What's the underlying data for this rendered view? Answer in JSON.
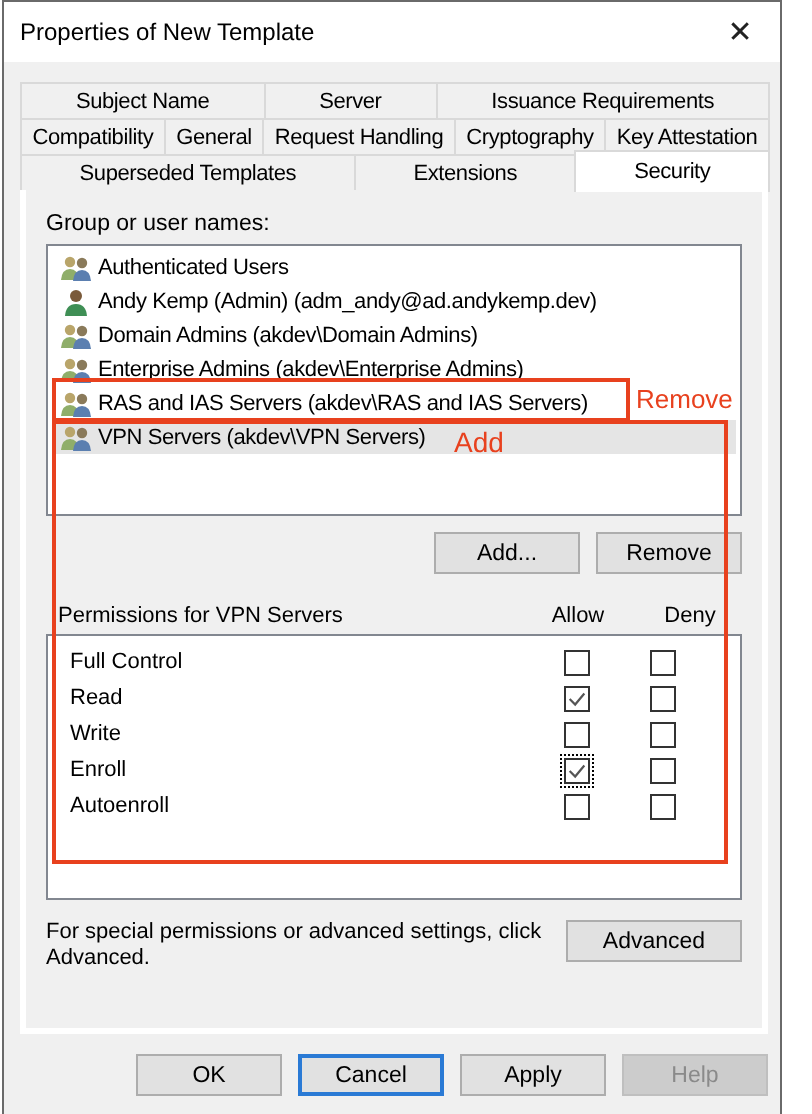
{
  "window": {
    "title": "Properties of New Template",
    "close": "✕"
  },
  "tab_rows": [
    [
      {
        "label": "Subject Name",
        "selected": false
      },
      {
        "label": "Server",
        "selected": false
      },
      {
        "label": "Issuance Requirements",
        "selected": false
      }
    ],
    [
      {
        "label": "Compatibility",
        "selected": false
      },
      {
        "label": "General",
        "selected": false
      },
      {
        "label": "Request Handling",
        "selected": false
      },
      {
        "label": "Cryptography",
        "selected": false
      },
      {
        "label": "Key Attestation",
        "selected": false
      }
    ],
    [
      {
        "label": "Superseded Templates",
        "selected": false
      },
      {
        "label": "Extensions",
        "selected": false
      },
      {
        "label": "Security",
        "selected": true
      }
    ]
  ],
  "group_label": "Group or user names:",
  "principals": [
    {
      "kind": "group",
      "name": "Authenticated Users",
      "selected": false
    },
    {
      "kind": "user",
      "name": "Andy Kemp (Admin) (adm_andy@ad.andykemp.dev)",
      "selected": false
    },
    {
      "kind": "group",
      "name": "Domain Admins (akdev\\Domain Admins)",
      "selected": false
    },
    {
      "kind": "group",
      "name": "Enterprise Admins (akdev\\Enterprise Admins)",
      "selected": false
    },
    {
      "kind": "group",
      "name": "RAS and IAS Servers (akdev\\RAS and IAS Servers)",
      "selected": false
    },
    {
      "kind": "group",
      "name": "VPN Servers (akdev\\VPN Servers)",
      "selected": true
    }
  ],
  "list_buttons": [
    "Add...",
    "Remove"
  ],
  "permissions": {
    "label": "Permissions for VPN Servers",
    "columns": [
      "Allow",
      "Deny"
    ],
    "rows": [
      {
        "name": "Full Control",
        "allow": false,
        "deny": false,
        "focused": false
      },
      {
        "name": "Read",
        "allow": true,
        "deny": false,
        "focused": false
      },
      {
        "name": "Write",
        "allow": false,
        "deny": false,
        "focused": false
      },
      {
        "name": "Enroll",
        "allow": true,
        "deny": false,
        "focused": true
      },
      {
        "name": "Autoenroll",
        "allow": false,
        "deny": false,
        "focused": false
      }
    ]
  },
  "advanced": {
    "text": "For special permissions or advanced settings, click Advanced.",
    "button": "Advanced"
  },
  "buttons": [
    {
      "label": "OK",
      "default": false,
      "disabled": false
    },
    {
      "label": "Cancel",
      "default": true,
      "disabled": false
    },
    {
      "label": "Apply",
      "default": false,
      "disabled": false
    },
    {
      "label": "Help",
      "default": false,
      "disabled": true
    }
  ],
  "annotations": [
    {
      "text": "Remove"
    },
    {
      "text": "Add"
    }
  ]
}
